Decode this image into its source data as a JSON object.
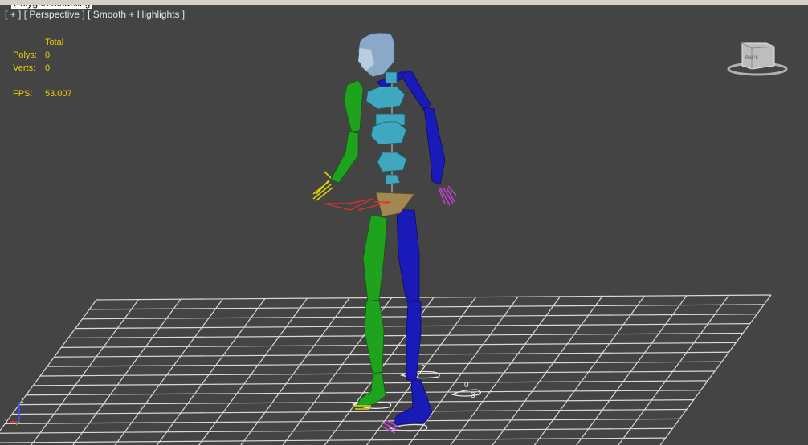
{
  "ribbon": {
    "active_tab": "Polygon Modeling"
  },
  "viewport": {
    "labels": {
      "plus": "[ + ]",
      "view": "[ Perspective ]",
      "shading": "[ Smooth + Highlights ]"
    }
  },
  "statistics": {
    "header": "Total",
    "polys_label": "Polys:",
    "polys_value": "0",
    "verts_label": "Verts:",
    "verts_value": "0",
    "fps_label": "FPS:",
    "fps_value": "53.007"
  },
  "viewcube": {
    "face_label": "BACK"
  },
  "scene": {
    "object": "biped-skeleton",
    "grid": "home-grid",
    "footstep_labels": [
      "2",
      "0",
      "3"
    ]
  },
  "axis_tripod": {
    "z": "z",
    "x": "x"
  },
  "colors": {
    "viewport_bg": "#444444",
    "grid": "#d9d9d9",
    "left_limbs": "#1fa31f",
    "right_limbs": "#1a1ab8",
    "spine": "#3fa7c0",
    "head": "#8aa9c8",
    "pelvis": "#a08850",
    "stats_text": "#f0d000"
  }
}
